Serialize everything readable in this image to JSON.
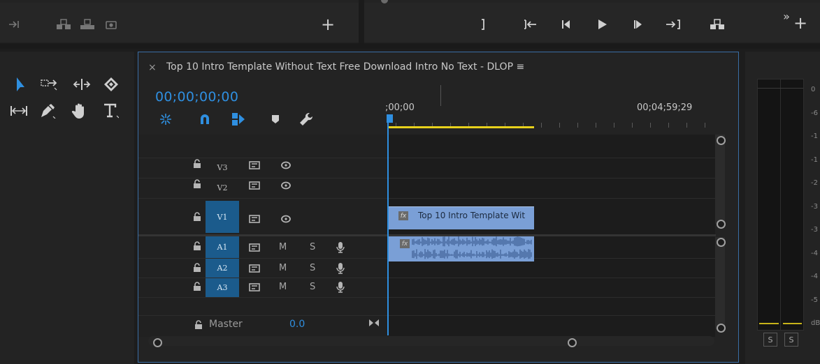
{
  "sequence": {
    "title": "Top 10 Intro Template Without Text Free Download Intro No Text - DLOP ≡",
    "close_glyph": "×",
    "timecode": "00;00;00;00",
    "ruler_start": ";00;00",
    "ruler_end": "00;04;59;29"
  },
  "tracks": {
    "video": [
      {
        "label": "V3",
        "targeted": false
      },
      {
        "label": "V2",
        "targeted": false
      },
      {
        "label": "V1",
        "targeted": true
      }
    ],
    "audio": [
      {
        "label": "A1",
        "mute": "M",
        "solo": "S"
      },
      {
        "label": "A2",
        "mute": "M",
        "solo": "S"
      },
      {
        "label": "A3",
        "mute": "M",
        "solo": "S"
      }
    ],
    "master": {
      "label": "Master",
      "value": "0.0"
    }
  },
  "clips": {
    "video_clip_label": "Top 10 Intro Template Wit",
    "fx_badge": "fx"
  },
  "meter": {
    "scale": [
      "0",
      "-6",
      "-1",
      "-1",
      "-2",
      "-3",
      "-3",
      "-4",
      "-4",
      "-5",
      "dB"
    ],
    "solo_left": "S",
    "solo_right": "S"
  },
  "top_panel": {
    "add_glyph": "+",
    "overflow_glyph": "»"
  },
  "icons": {
    "source_toolbar": [
      "insert-arrow-icon",
      "lift-icon",
      "extract-icon",
      "camera-icon",
      "add-icon"
    ],
    "program_toolbar": [
      "mark-out-icon",
      "go-to-in-icon",
      "step-back-icon",
      "play-icon",
      "step-forward-icon",
      "go-to-out-icon",
      "lift-icon",
      "overflow-icon",
      "add-icon"
    ],
    "tools": [
      "selection-tool-icon",
      "track-select-tool-icon",
      "ripple-edit-tool-icon",
      "razor-tool-icon",
      "slip-tool-icon",
      "pen-tool-icon",
      "hand-tool-icon",
      "type-tool-icon"
    ],
    "timeline_toolbar": [
      "nest-icon",
      "snap-icon",
      "linked-selection-icon",
      "marker-icon",
      "wrench-icon"
    ]
  },
  "colors": {
    "accent_blue": "#2f8fe0",
    "clip_blue": "#7a9fd6",
    "work_area_yellow": "#e7d11c",
    "track_target": "#1b5b8c"
  }
}
